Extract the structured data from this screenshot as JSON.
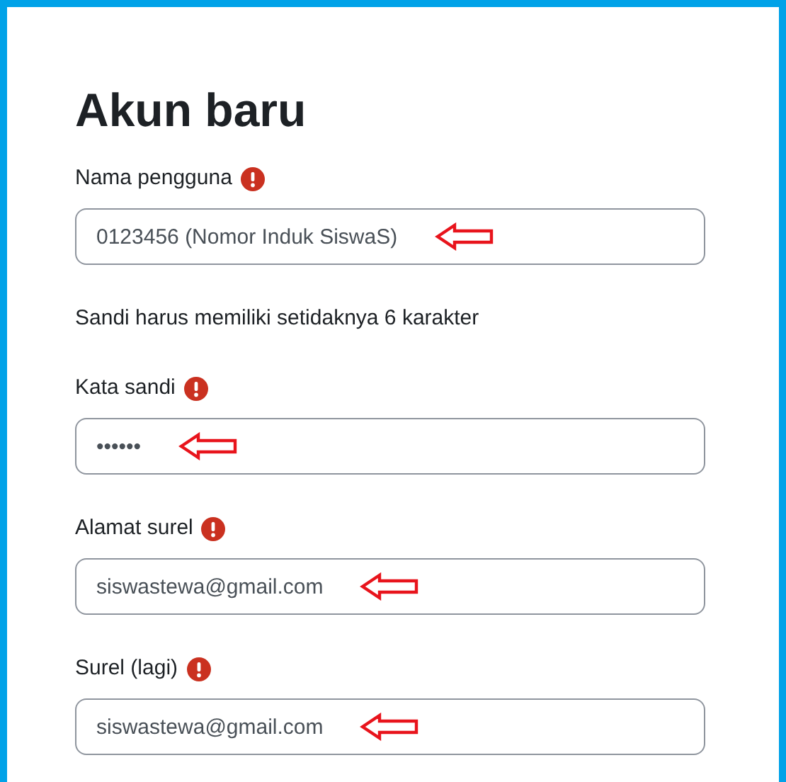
{
  "title": "Akun baru",
  "fields": [
    {
      "label": "Nama pengguna",
      "required": true,
      "value": "0123456 (Nomor Induk SiswaS)",
      "annotated": true
    },
    {
      "hint": "Sandi harus memiliki setidaknya 6 karakter",
      "label": "Kata sandi",
      "required": true,
      "value": "••••••",
      "annotated": true
    },
    {
      "label": "Alamat surel",
      "required": true,
      "value": "siswastewa@gmail.com",
      "annotated": true
    },
    {
      "label": "Surel (lagi)",
      "required": true,
      "value": "siswastewa@gmail.com",
      "annotated": true
    }
  ]
}
